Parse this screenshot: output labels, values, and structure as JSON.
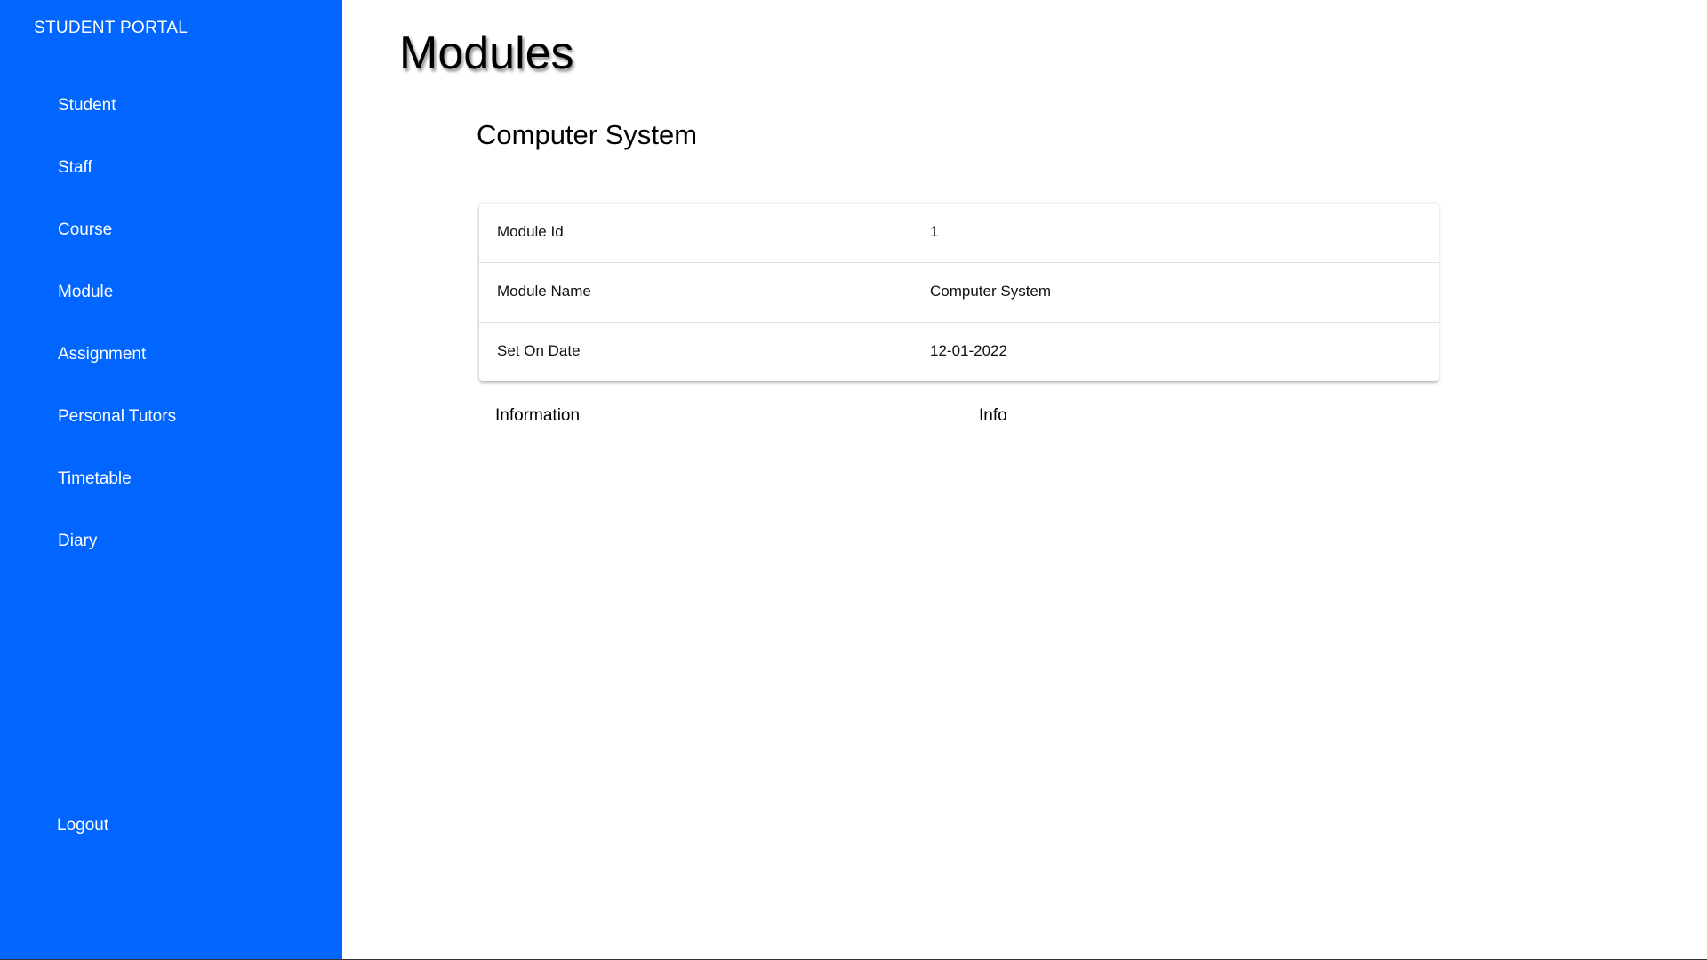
{
  "sidebar": {
    "brand": "STUDENT PORTAL",
    "items": [
      {
        "label": "Student"
      },
      {
        "label": "Staff"
      },
      {
        "label": "Course"
      },
      {
        "label": "Module"
      },
      {
        "label": "Assignment"
      },
      {
        "label": "Personal Tutors"
      },
      {
        "label": "Timetable"
      },
      {
        "label": "Diary"
      }
    ],
    "logout_label": "Logout",
    "background_color": "#0066ff"
  },
  "main": {
    "page_title": "Modules",
    "module_heading": "Computer System",
    "details": [
      {
        "label": "Module Id",
        "value": "1"
      },
      {
        "label": "Module Name",
        "value": "Computer System"
      },
      {
        "label": "Set On Date",
        "value": "12-01-2022"
      }
    ],
    "info_label": "Information",
    "info_value": "Info"
  }
}
